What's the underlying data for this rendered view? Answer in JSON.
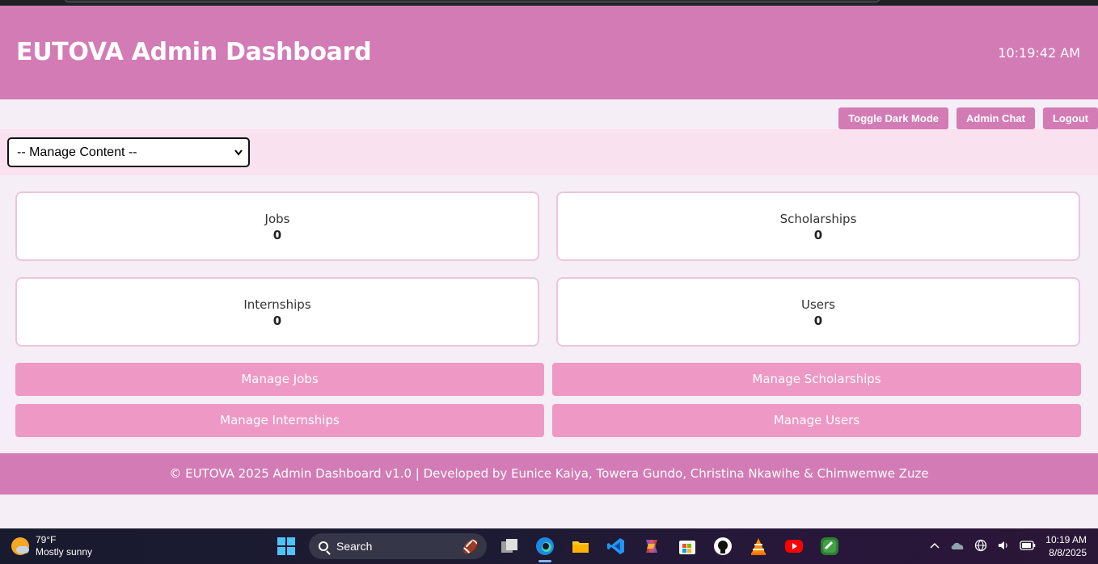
{
  "header": {
    "title": "EUTOVA Admin Dashboard",
    "time": "10:19:42 AM"
  },
  "actions": {
    "toggle_dark_mode": "Toggle Dark Mode",
    "admin_chat": "Admin Chat",
    "logout": "Logout"
  },
  "manage_select": {
    "selected": "-- Manage Content --"
  },
  "stats": [
    {
      "label": "Jobs",
      "count": "0"
    },
    {
      "label": "Scholarships",
      "count": "0"
    },
    {
      "label": "Internships",
      "count": "0"
    },
    {
      "label": "Users",
      "count": "0"
    }
  ],
  "manage_buttons": [
    {
      "label": "Manage Jobs"
    },
    {
      "label": "Manage Scholarships"
    },
    {
      "label": "Manage Internships"
    },
    {
      "label": "Manage Users"
    }
  ],
  "footer": {
    "text": "© EUTOVA 2025 Admin Dashboard v1.0 | Developed by Eunice Kaiya, Towera Gundo, Christina Nkawihe & Chimwemwe Zuze"
  },
  "taskbar": {
    "weather_temp": "79°F",
    "weather_desc": "Mostly sunny",
    "search_label": "Search",
    "clock_time": "10:19 AM",
    "clock_date": "8/8/2025",
    "apps": [
      "windows-start-icon",
      "task-view-icon",
      "edge-icon",
      "file-explorer-icon",
      "vscode-icon",
      "copilot-icon",
      "store-icon",
      "github-icon",
      "vlc-icon",
      "youtube-icon",
      "app-green-icon"
    ]
  },
  "colors": {
    "header": "#d37bb5",
    "manage_bar": "#f9e1ef",
    "button": "#ee98c5",
    "card_border": "#ebc6dd",
    "page_bg": "#f5eef6"
  }
}
